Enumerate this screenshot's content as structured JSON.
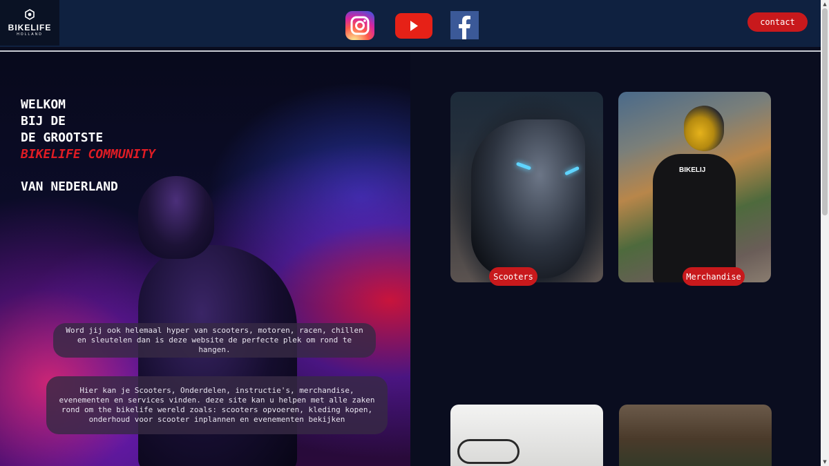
{
  "header": {
    "logo": {
      "name": "BIKELIFE",
      "sub": "HOLLAND"
    },
    "social": [
      {
        "icon": "instagram-icon"
      },
      {
        "icon": "youtube-icon"
      },
      {
        "icon": "facebook-icon"
      }
    ],
    "contact_label": "contact"
  },
  "hero": {
    "lines": [
      "WELKOM",
      "BIJ DE",
      "DE GROOTSTE"
    ],
    "accent_line": "BIKELIFE COMMUNITY",
    "last_line": "VAN NEDERLAND",
    "intro": "Word jij ook helemaal hyper van scooters, motoren, racen, chillen en sleutelen dan is deze website de perfecte plek om rond te hangen.",
    "description": "Hier kan je Scooters, Onderdelen, instructie's, merchandise, evenementen en services vinden. deze site kan u helpen met alle zaken rond om the bikelife wereld zoals: scooters opvoeren, kleding kopen, onderhoud voor scooter inplannen en evenementen bekijken"
  },
  "cards": [
    {
      "label": "Scooters"
    },
    {
      "label": "Merchandise"
    }
  ],
  "merch_print": "BIKELIJ",
  "colors": {
    "header_bg": "#0f2140",
    "page_bg": "#0a0d1f",
    "accent_red": "#c8191c",
    "headline_red": "#e01c24"
  }
}
